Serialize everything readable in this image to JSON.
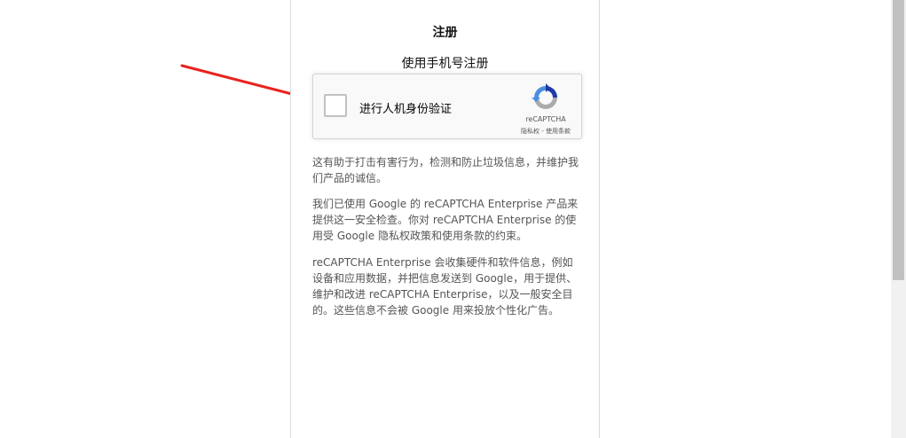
{
  "page": {
    "title": "注册",
    "subtitle": "使用手机号注册"
  },
  "recaptcha": {
    "checkbox_label": "进行人机身份验证",
    "brand": "reCAPTCHA",
    "privacy_link": "隐私权",
    "separator": " - ",
    "terms_link": "使用条款"
  },
  "description": {
    "p1": "这有助于打击有害行为，检测和防止垃圾信息，并维护我们产品的诚信。",
    "p2": "我们已使用 Google 的 reCAPTCHA Enterprise 产品来提供这一安全检查。你对 reCAPTCHA Enterprise 的使用受 Google 隐私权政策和使用条款的约束。",
    "p3": "reCAPTCHA Enterprise 会收集硬件和软件信息，例如设备和应用数据，并把信息发送到 Google，用于提供、维护和改进 reCAPTCHA Enterprise，以及一般安全目的。这些信息不会被 Google 用来投放个性化广告。"
  },
  "colors": {
    "arrow": "#e8231f",
    "recaptcha_blue": "#1c3aa9",
    "recaptcha_lightblue": "#4a90e2",
    "recaptcha_gray": "#ababab"
  }
}
